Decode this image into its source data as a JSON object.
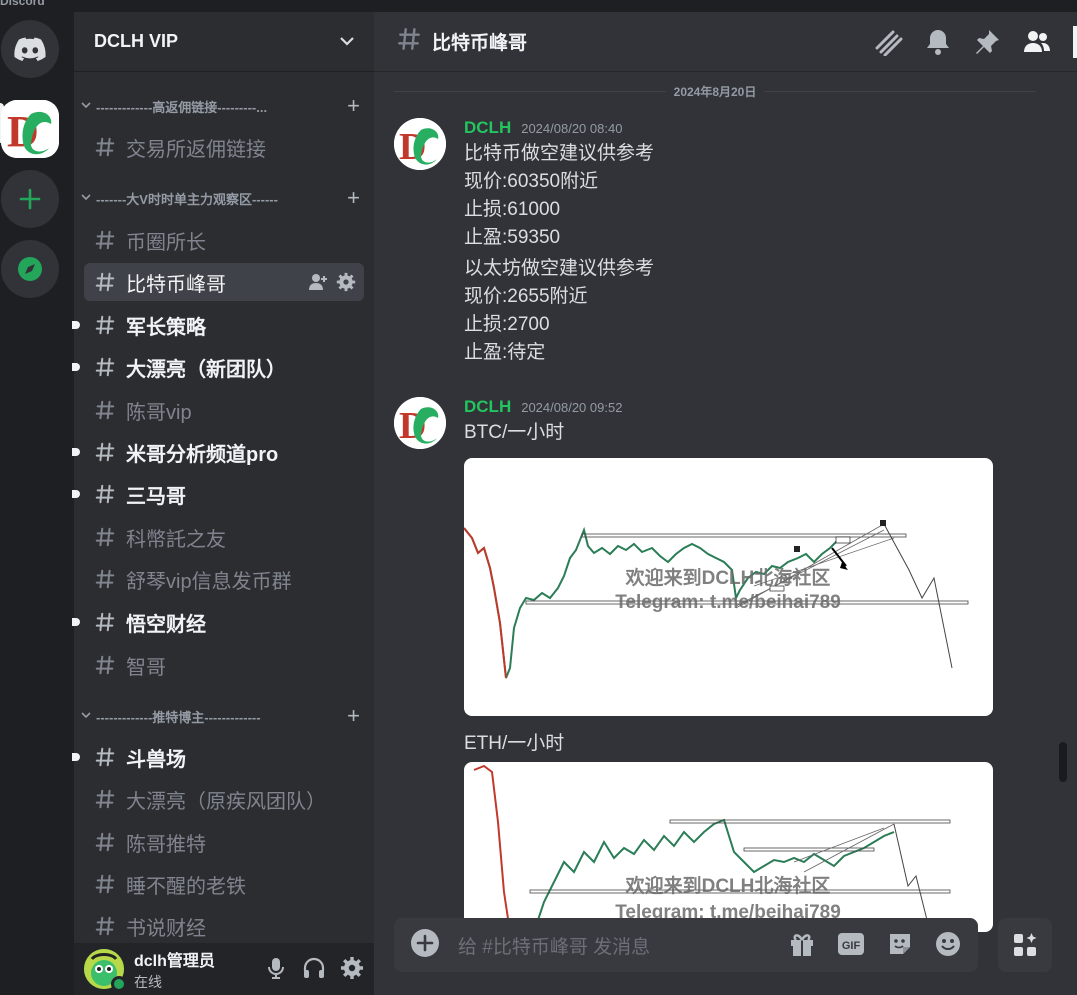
{
  "window_title": "Discord",
  "colors": {
    "accent_green": "#23c55e",
    "selected_bg": "#404249",
    "sidebar_bg": "#2b2d31",
    "main_bg": "#313338",
    "rail_bg": "#1e1f22"
  },
  "rail": {
    "items": [
      {
        "name": "discord-home-icon"
      },
      {
        "name": "dclh-server-icon"
      },
      {
        "name": "add-server-icon"
      },
      {
        "name": "explore-discovery-icon"
      }
    ]
  },
  "guild": {
    "name": "DCLH VIP"
  },
  "categories": [
    {
      "label": "-------------高返佣链接---------...",
      "channels": [
        {
          "label": "交易所返佣链接",
          "state": "normal"
        }
      ]
    },
    {
      "label": "-------大V时时单主力观察区------",
      "channels": [
        {
          "label": "币圈所长",
          "state": "normal"
        },
        {
          "label": "比特币峰哥",
          "state": "selected"
        },
        {
          "label": "军长策略",
          "state": "unread"
        },
        {
          "label": "大漂亮（新团队）",
          "state": "unread"
        },
        {
          "label": "陈哥vip",
          "state": "normal"
        },
        {
          "label": "米哥分析频道pro",
          "state": "unread"
        },
        {
          "label": "三马哥",
          "state": "unread"
        },
        {
          "label": "科幣託之友",
          "state": "normal"
        },
        {
          "label": "舒琴vip信息发币群",
          "state": "normal"
        },
        {
          "label": "悟空财经",
          "state": "unread"
        },
        {
          "label": "智哥",
          "state": "normal"
        }
      ]
    },
    {
      "label": "-------------推特博主-------------",
      "channels": [
        {
          "label": "斗兽场",
          "state": "unread"
        },
        {
          "label": "大漂亮（原疾风团队）",
          "state": "normal"
        },
        {
          "label": "陈哥推特",
          "state": "normal"
        },
        {
          "label": "睡不醒的老铁",
          "state": "normal"
        },
        {
          "label": "书说财经",
          "state": "normal"
        }
      ]
    }
  ],
  "user": {
    "name": "dclh管理员",
    "status": "在线"
  },
  "channel": {
    "title": "比特币峰哥"
  },
  "date_divider": "2024年8月20日",
  "messages": [
    {
      "author": "DCLH",
      "timestamp": "2024/08/20 08:40",
      "lines": [
        "比特币做空建议供参考",
        "现价:60350附近",
        "止损:61000",
        "止盈:59350",
        "以太坊做空建议供参考",
        "现价:2655附近",
        "止损:2700",
        "止盈:待定"
      ]
    },
    {
      "author": "DCLH",
      "timestamp": "2024/08/20 09:52",
      "lines": [
        "BTC/一小时"
      ],
      "image_caption_2": "ETH/一小时",
      "watermark_1": "欢迎来到DCLH北海社区",
      "watermark_2": "Telegram: t.me/beihai789"
    }
  ],
  "composer": {
    "placeholder": "给 #比特币峰哥 发消息"
  }
}
